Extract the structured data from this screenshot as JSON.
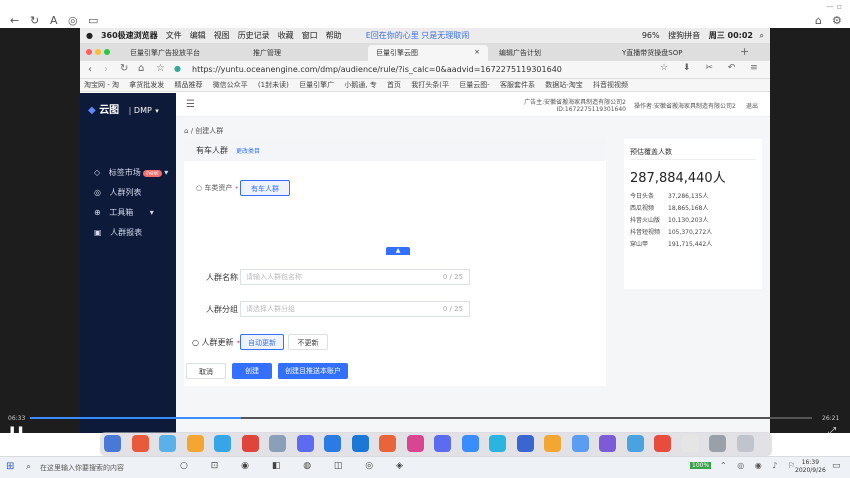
{
  "player": {
    "time_left": "06:33",
    "time_right": "26:21",
    "progress": 0.27
  },
  "mac": {
    "app": "360极速浏览器",
    "menus": [
      "文件",
      "编辑",
      "视图",
      "历史记录",
      "收藏",
      "窗口",
      "帮助"
    ],
    "notice": "E回在你的心里 只是无理取闹",
    "battery": "96%",
    "clock": "周三 00:02",
    "ime": "搜狗拼音"
  },
  "browser": {
    "tabs": [
      {
        "label": "巨量引擎广告投放平台",
        "active": false
      },
      {
        "label": "推广管理",
        "active": false
      },
      {
        "label": "巨量引擎云图",
        "active": true
      },
      {
        "label": "编辑广告计划",
        "active": false
      },
      {
        "label": "Y直播带货操盘SOP",
        "active": false
      }
    ],
    "url": "https://yuntu.oceanengine.com/dmp/audience/rule/?is_calc=0&aadvid=1672275119301640",
    "bookmarks": [
      "淘宝网 - 淘",
      "拿货批发发",
      "精品推荐",
      "微信公众平",
      "(1封未读)",
      "巨量引擎广",
      "小鹅通, 专",
      "首页",
      "我打头条(平",
      "巨量云图-",
      "客服套件系",
      "数据站-淘宝",
      "抖音视视频"
    ]
  },
  "app": {
    "brand": "云图",
    "module": "DMP",
    "sidebar": [
      {
        "label": "标签市场",
        "badge": "new"
      },
      {
        "label": "人群列表"
      },
      {
        "label": "工具箱"
      },
      {
        "label": "人群报表"
      }
    ],
    "account_left": "广告主:安徽省搬海家具制造有限公司2",
    "account_id": "ID:1672275119301640",
    "account_right": "操作者:安徽省搬海家具制造有限公司2",
    "logout": "退出",
    "breadcrumb": "/ 创建人群",
    "rule_title": "有车人群",
    "rule_edit": "更改类目",
    "asset_label": "车类资产",
    "asset_tag": "有车人群",
    "name_label": "人群名称",
    "name_placeholder": "请输入人群包名称",
    "name_count": "0 / 25",
    "group_label": "人群分组",
    "group_placeholder": "请选择人群分组",
    "group_count": "0 / 25",
    "update_label": "人群更新",
    "update_auto": "自动更新",
    "update_none": "不更新",
    "cancel": "取消",
    "create": "创建",
    "create_push": "创建且推送本账户",
    "coverage_title": "预估覆盖人数",
    "coverage_total": "287,884,440人",
    "coverage_rows": [
      {
        "name": "今日头条",
        "value": "37,286,135人"
      },
      {
        "name": "西瓜视频",
        "value": "18,865,168人"
      },
      {
        "name": "抖音火山版",
        "value": "10,130,203人"
      },
      {
        "name": "抖音短视频",
        "value": "105,370,272人"
      },
      {
        "name": "穿山甲",
        "value": "191,715,442人"
      }
    ]
  },
  "taskbar": {
    "search": "在这里输入你要搜索的内容",
    "time": "16:39",
    "date": "2020/9/26",
    "battery": "100%"
  }
}
